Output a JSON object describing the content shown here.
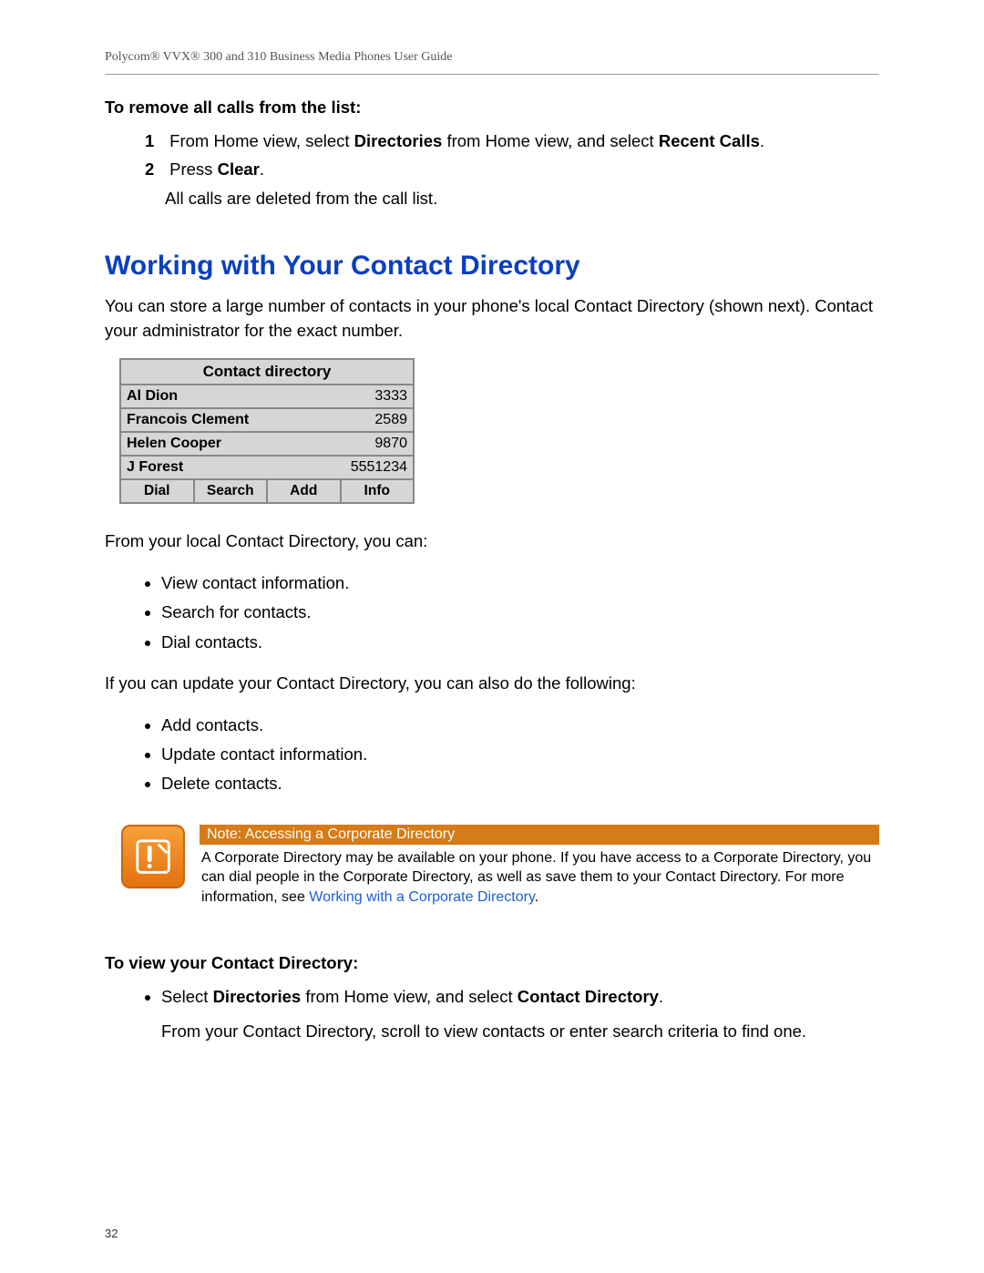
{
  "header": "Polycom® VVX® 300 and 310 Business Media Phones User Guide",
  "section1": {
    "heading": "To remove all calls from the list:",
    "step1_num": "1",
    "step1_pre": "From Home view, select ",
    "step1_b1": "Directories",
    "step1_mid": " from Home view, and select ",
    "step1_b2": "Recent Calls",
    "step1_post": ".",
    "step2_num": "2",
    "step2_pre": "Press ",
    "step2_b1": "Clear",
    "step2_post": ".",
    "step2_sub": "All calls are deleted from the call list."
  },
  "h2": "Working with Your Contact Directory",
  "intro": "You can store a large number of contacts in your phone's local Contact Directory (shown next). Contact your administrator for the exact number.",
  "phone": {
    "title": "Contact directory",
    "rows": [
      {
        "name": "Al Dion",
        "num": "3333",
        "selected": true
      },
      {
        "name": "Francois Clement",
        "num": "2589",
        "selected": false
      },
      {
        "name": "Helen Cooper",
        "num": "9870",
        "selected": false
      },
      {
        "name": "J Forest",
        "num": "5551234",
        "selected": false
      }
    ],
    "softkeys": [
      "Dial",
      "Search",
      "Add",
      "Info"
    ]
  },
  "p_after_phone": "From your local Contact Directory, you can:",
  "ul1": [
    "View contact information.",
    "Search for contacts.",
    "Dial contacts."
  ],
  "p_update": "If you can update your Contact Directory, you can also do the following:",
  "ul2": [
    "Add contacts.",
    "Update contact information.",
    "Delete contacts."
  ],
  "note": {
    "title": "Note: Accessing a Corporate Directory",
    "body_pre": "A Corporate Directory may be available on your phone. If you have access to a Corporate Directory, you can dial people in the Corporate Directory, as well as save them to your Contact Directory. For more information, see ",
    "body_link": "Working with a Corporate Directory",
    "body_post": "."
  },
  "section2": {
    "heading": "To view your Contact Directory:",
    "bullet_pre": "Select ",
    "bullet_b1": "Directories",
    "bullet_mid": " from Home view, and select ",
    "bullet_b2": "Contact Directory",
    "bullet_post": ".",
    "bullet_sub": "From your Contact Directory, scroll to view contacts or enter search criteria to find one."
  },
  "pagenum": "32"
}
